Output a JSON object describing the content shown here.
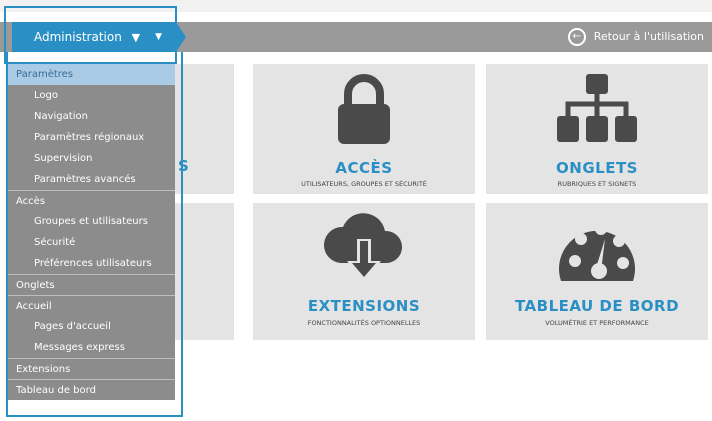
{
  "toolbar": {
    "admin_label": "Administration",
    "back_label": "Retour à l'utilisation"
  },
  "menu": [
    {
      "label": "Paramètres",
      "level": "parent",
      "active": true
    },
    {
      "label": "Logo",
      "level": "sub"
    },
    {
      "label": "Navigation",
      "level": "sub"
    },
    {
      "label": "Paramètres régionaux",
      "level": "sub"
    },
    {
      "label": "Supervision",
      "level": "sub"
    },
    {
      "label": "Paramètres avancés",
      "level": "sub"
    },
    {
      "label": "Accès",
      "level": "parent"
    },
    {
      "label": "Groupes et utilisateurs",
      "level": "sub"
    },
    {
      "label": "Sécurité",
      "level": "sub"
    },
    {
      "label": "Préférences utilisateurs",
      "level": "sub"
    },
    {
      "label": "Onglets",
      "level": "parent"
    },
    {
      "label": "Accueil",
      "level": "parent"
    },
    {
      "label": "Pages d'accueil",
      "level": "sub"
    },
    {
      "label": "Messages express",
      "level": "sub"
    },
    {
      "label": "Extensions",
      "level": "parent"
    },
    {
      "label": "Tableau de bord",
      "level": "parent"
    }
  ],
  "hidden_tile_fragment": "S",
  "tiles": {
    "acces": {
      "title": "ACCÈS",
      "subtitle": "UTILISATEURS, GROUPES ET SÉCURITÉ",
      "icon": "lock-icon"
    },
    "onglets": {
      "title": "ONGLETS",
      "subtitle": "RUBRIQUES ET SIGNETS",
      "icon": "sitemap-icon"
    },
    "extensions": {
      "title": "EXTENSIONS",
      "subtitle": "FONCTIONNALITÉS OPTIONNELLES",
      "icon": "cloud-download-icon"
    },
    "tableau": {
      "title": "TABLEAU DE BORD",
      "subtitle": "VOLUMÉTRIE ET PERFORMANCE",
      "icon": "gauge-icon"
    }
  },
  "colors": {
    "accent": "#2a8fc5",
    "toolbar": "#9a9a9a",
    "tile": "#e4e4e4",
    "menu": "#8c8c8c",
    "menu_active": "#a9cbe6",
    "icon": "#4a4a4a"
  }
}
